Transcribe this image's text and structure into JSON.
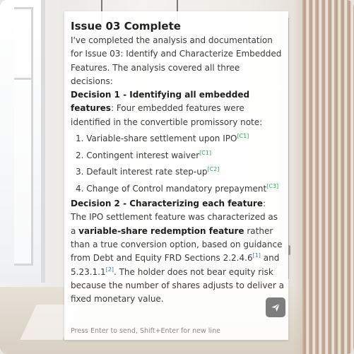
{
  "message": {
    "title": "Issue 03 Complete",
    "intro": "I've completed the analysis and documentation for Issue 03: Identify and Characterize Embedded Features. The analysis covered all three decisions:",
    "decision1": {
      "heading": "Decision 1 - Identifying all embedded features",
      "after_heading": ":",
      "text": "Four embedded features were identified in the convertible promissory note:",
      "items": [
        {
          "text": "Variable-share settlement upon IPO",
          "cite": "[C1]"
        },
        {
          "text": "Contingent interest waiver",
          "cite": "[C1]"
        },
        {
          "text": "Default interest rate step-up",
          "cite": "[C2]"
        },
        {
          "text": "Change of Control mandatory prepayment",
          "cite": "[C3]"
        }
      ]
    },
    "decision2": {
      "heading": "Decision 2 - Characterizing each feature",
      "text_a": ": The IPO settlement feature was characterized as a ",
      "bold_b": "variable-share redemption feature",
      "text_c": " rather than a true conversion option, based on guidance from Debt and Equity FRD Sections 2.2.4.6",
      "ref1": "[1]",
      "text_d": " and 5.23.1.1",
      "ref2": "[2]",
      "text_e": ". The holder does not bear equity risk because the number of shares adjusts to deliver a fixed monetary value."
    }
  },
  "composer": {
    "hint": "Press Enter to send, Shift+Enter for new line",
    "send_icon": "paper-plane-icon"
  }
}
